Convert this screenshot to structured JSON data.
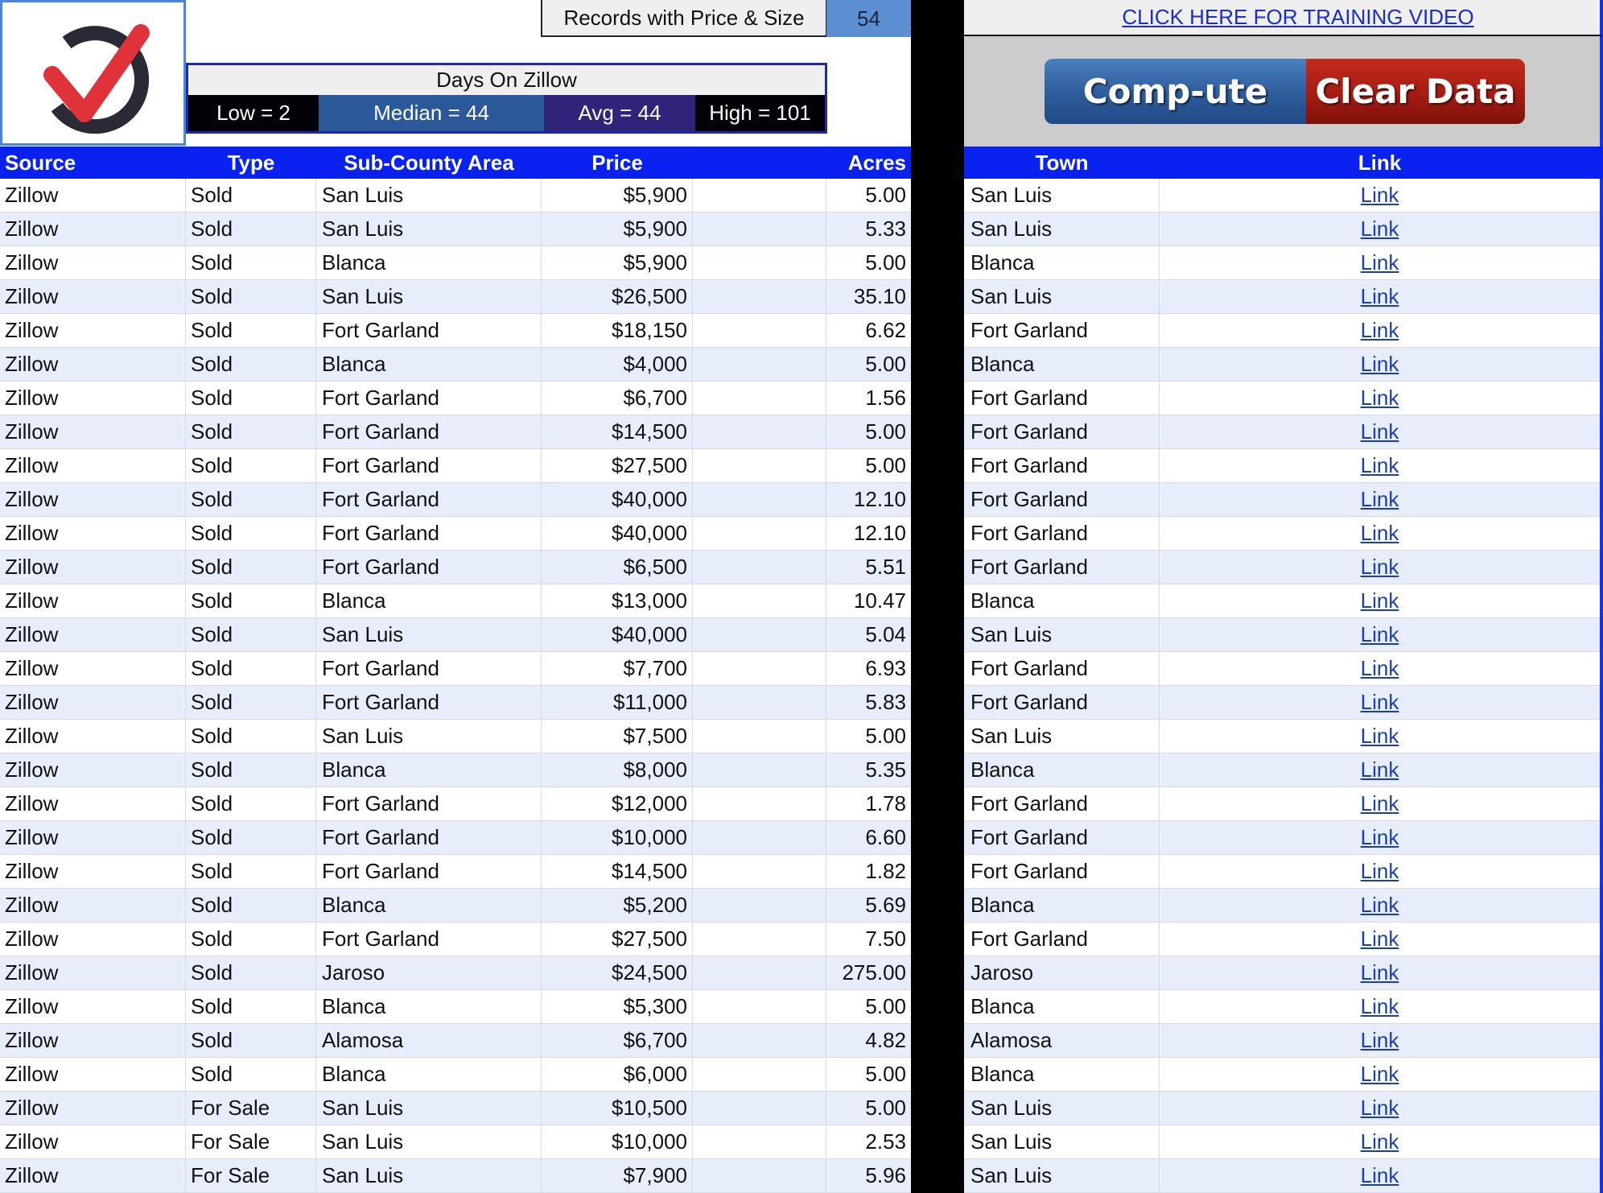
{
  "records": {
    "label": "Records with Price & Size",
    "value": "54"
  },
  "days_on_zillow": {
    "title": "Days On Zillow",
    "low": "Low = 2",
    "median": "Median = 44",
    "avg": "Avg = 44",
    "high": "High = 101"
  },
  "training_link": "CLICK HERE FOR TRAINING VIDEO",
  "buttons": {
    "compute": "Comp-ute",
    "clear": "Clear Data"
  },
  "colors": {
    "header_blue": "#0a22f0",
    "compute_blue": "#2d5c9a",
    "clear_red": "#a51c12",
    "row_alt": "#e7edfa",
    "link_blue": "#1a3fb5"
  },
  "left_table": {
    "headers": {
      "source": "Source",
      "type": "Type",
      "area": "Sub-County Area",
      "price": "Price",
      "acres": "Acres"
    },
    "rows": [
      {
        "source": "Zillow",
        "type": "Sold",
        "area": "San Luis",
        "price": "$5,900",
        "acres": "5.00"
      },
      {
        "source": "Zillow",
        "type": "Sold",
        "area": "San Luis",
        "price": "$5,900",
        "acres": "5.33"
      },
      {
        "source": "Zillow",
        "type": "Sold",
        "area": "Blanca",
        "price": "$5,900",
        "acres": "5.00"
      },
      {
        "source": "Zillow",
        "type": "Sold",
        "area": "San Luis",
        "price": "$26,500",
        "acres": "35.10"
      },
      {
        "source": "Zillow",
        "type": "Sold",
        "area": "Fort Garland",
        "price": "$18,150",
        "acres": "6.62"
      },
      {
        "source": "Zillow",
        "type": "Sold",
        "area": "Blanca",
        "price": "$4,000",
        "acres": "5.00"
      },
      {
        "source": "Zillow",
        "type": "Sold",
        "area": "Fort Garland",
        "price": "$6,700",
        "acres": "1.56"
      },
      {
        "source": "Zillow",
        "type": "Sold",
        "area": "Fort Garland",
        "price": "$14,500",
        "acres": "5.00"
      },
      {
        "source": "Zillow",
        "type": "Sold",
        "area": "Fort Garland",
        "price": "$27,500",
        "acres": "5.00"
      },
      {
        "source": "Zillow",
        "type": "Sold",
        "area": "Fort Garland",
        "price": "$40,000",
        "acres": "12.10"
      },
      {
        "source": "Zillow",
        "type": "Sold",
        "area": "Fort Garland",
        "price": "$40,000",
        "acres": "12.10"
      },
      {
        "source": "Zillow",
        "type": "Sold",
        "area": "Fort Garland",
        "price": "$6,500",
        "acres": "5.51"
      },
      {
        "source": "Zillow",
        "type": "Sold",
        "area": "Blanca",
        "price": "$13,000",
        "acres": "10.47"
      },
      {
        "source": "Zillow",
        "type": "Sold",
        "area": "San Luis",
        "price": "$40,000",
        "acres": "5.04"
      },
      {
        "source": "Zillow",
        "type": "Sold",
        "area": "Fort Garland",
        "price": "$7,700",
        "acres": "6.93"
      },
      {
        "source": "Zillow",
        "type": "Sold",
        "area": "Fort Garland",
        "price": "$11,000",
        "acres": "5.83"
      },
      {
        "source": "Zillow",
        "type": "Sold",
        "area": "San Luis",
        "price": "$7,500",
        "acres": "5.00"
      },
      {
        "source": "Zillow",
        "type": "Sold",
        "area": "Blanca",
        "price": "$8,000",
        "acres": "5.35"
      },
      {
        "source": "Zillow",
        "type": "Sold",
        "area": "Fort Garland",
        "price": "$12,000",
        "acres": "1.78"
      },
      {
        "source": "Zillow",
        "type": "Sold",
        "area": "Fort Garland",
        "price": "$10,000",
        "acres": "6.60"
      },
      {
        "source": "Zillow",
        "type": "Sold",
        "area": "Fort Garland",
        "price": "$14,500",
        "acres": "1.82"
      },
      {
        "source": "Zillow",
        "type": "Sold",
        "area": "Blanca",
        "price": "$5,200",
        "acres": "5.69"
      },
      {
        "source": "Zillow",
        "type": "Sold",
        "area": "Fort Garland",
        "price": "$27,500",
        "acres": "7.50"
      },
      {
        "source": "Zillow",
        "type": "Sold",
        "area": "Jaroso",
        "price": "$24,500",
        "acres": "275.00"
      },
      {
        "source": "Zillow",
        "type": "Sold",
        "area": "Blanca",
        "price": "$5,300",
        "acres": "5.00"
      },
      {
        "source": "Zillow",
        "type": "Sold",
        "area": "Alamosa",
        "price": "$6,700",
        "acres": "4.82"
      },
      {
        "source": "Zillow",
        "type": "Sold",
        "area": "Blanca",
        "price": "$6,000",
        "acres": "5.00"
      },
      {
        "source": "Zillow",
        "type": "For Sale",
        "area": "San Luis",
        "price": "$10,500",
        "acres": "5.00"
      },
      {
        "source": "Zillow",
        "type": "For Sale",
        "area": "San Luis",
        "price": "$10,000",
        "acres": "2.53"
      },
      {
        "source": "Zillow",
        "type": "For Sale",
        "area": "San Luis",
        "price": "$7,900",
        "acres": "5.96"
      }
    ]
  },
  "right_table": {
    "headers": {
      "town": "Town",
      "link": "Link"
    },
    "rows": [
      {
        "town": "San Luis",
        "link": "Link"
      },
      {
        "town": "San Luis",
        "link": "Link"
      },
      {
        "town": "Blanca",
        "link": "Link"
      },
      {
        "town": "San Luis",
        "link": "Link"
      },
      {
        "town": "Fort Garland",
        "link": "Link"
      },
      {
        "town": "Blanca",
        "link": "Link"
      },
      {
        "town": "Fort Garland",
        "link": "Link"
      },
      {
        "town": "Fort Garland",
        "link": "Link"
      },
      {
        "town": "Fort Garland",
        "link": "Link"
      },
      {
        "town": "Fort Garland",
        "link": "Link"
      },
      {
        "town": "Fort Garland",
        "link": "Link"
      },
      {
        "town": "Fort Garland",
        "link": "Link"
      },
      {
        "town": "Blanca",
        "link": "Link"
      },
      {
        "town": "San Luis",
        "link": "Link"
      },
      {
        "town": "Fort Garland",
        "link": "Link"
      },
      {
        "town": "Fort Garland",
        "link": "Link"
      },
      {
        "town": "San Luis",
        "link": "Link"
      },
      {
        "town": "Blanca",
        "link": "Link"
      },
      {
        "town": "Fort Garland",
        "link": "Link"
      },
      {
        "town": "Fort Garland",
        "link": "Link"
      },
      {
        "town": "Fort Garland",
        "link": "Link"
      },
      {
        "town": "Blanca",
        "link": "Link"
      },
      {
        "town": "Fort Garland",
        "link": "Link"
      },
      {
        "town": "Jaroso",
        "link": "Link"
      },
      {
        "town": "Blanca",
        "link": "Link"
      },
      {
        "town": "Alamosa",
        "link": "Link"
      },
      {
        "town": "Blanca",
        "link": "Link"
      },
      {
        "town": "San Luis",
        "link": "Link"
      },
      {
        "town": "San Luis",
        "link": "Link"
      },
      {
        "town": "San Luis",
        "link": "Link"
      }
    ]
  }
}
